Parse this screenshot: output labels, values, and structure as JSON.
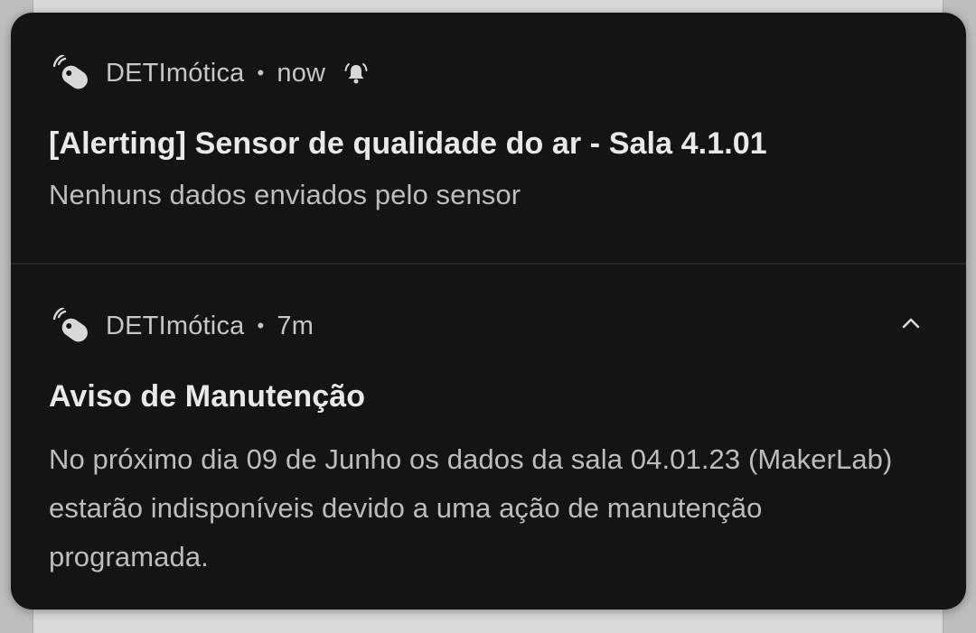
{
  "notifications": [
    {
      "app_name": "DETImótica",
      "separator": "•",
      "time": "now",
      "title": "[Alerting] Sensor de qualidade do ar - Sala 4.1.01",
      "body": "Nenhuns dados enviados pelo sensor",
      "icons": [
        "app-tag-icon",
        "alert-bell-icon"
      ]
    },
    {
      "app_name": "DETImótica",
      "separator": "•",
      "time": "7m",
      "title": "Aviso de Manutenção",
      "body": "No próximo dia 09 de Junho os dados da sala 04.01.23 (MakerLab) estarão indisponíveis devido a uma ação de manutenção programada.",
      "icons": [
        "app-tag-icon",
        "chevron-up-icon"
      ]
    }
  ],
  "colors": {
    "shade_background": "#141414",
    "title_text": "#e9e9e9",
    "secondary_text": "#c6c6c6",
    "divider": "#262626"
  }
}
